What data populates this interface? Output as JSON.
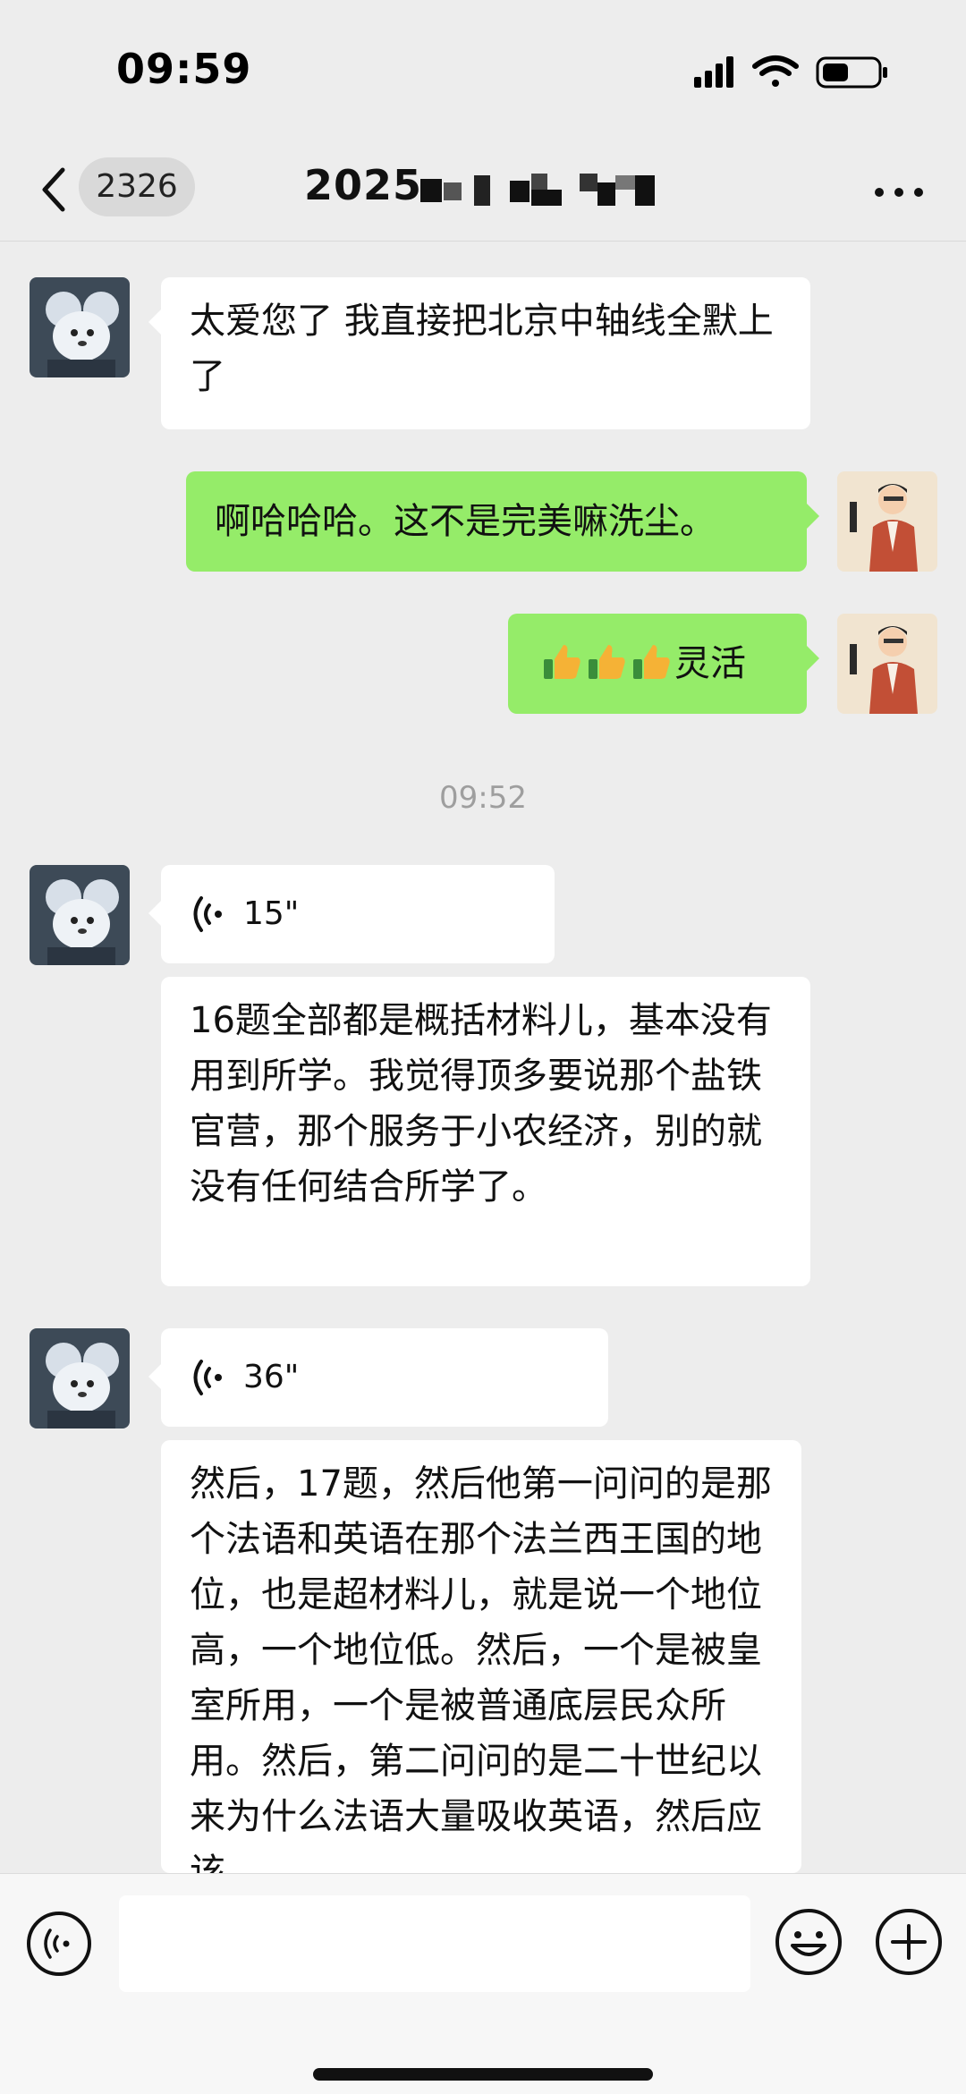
{
  "status_bar": {
    "time": "09:59"
  },
  "nav": {
    "unread_count": "2326",
    "title": "2025"
  },
  "messages": [
    {
      "id": "m1",
      "sender": "contact",
      "text": "太爱您了 我直接把北京中轴线全默上了"
    },
    {
      "id": "m2",
      "sender": "me",
      "text": "啊哈哈哈。这不是完美嘛洗尘。"
    },
    {
      "id": "m3",
      "sender": "me",
      "emoji": [
        "thumbs-up",
        "thumbs-up",
        "thumbs-up"
      ],
      "text": "灵活"
    },
    {
      "id": "t1",
      "type": "timestamp",
      "text": "09:52"
    },
    {
      "id": "v1",
      "sender": "contact",
      "type": "voice",
      "duration": "15\""
    },
    {
      "id": "m4",
      "sender": "contact",
      "text": "16题全部都是概括材料儿，基本没有用到所学。我觉得顶多要说那个盐铁官营，那个服务于小农经济，别的就没有任何结合所学了。"
    },
    {
      "id": "v2",
      "sender": "contact",
      "type": "voice",
      "duration": "36\""
    },
    {
      "id": "m5",
      "sender": "contact",
      "text": "然后，17题，然后他第一问问的是那个法语和英语在那个法兰西王国的地位，也是超材料儿，就是说一个地位高，一个地位低。然后，一个是被皇室所用，一个是被普通底层民众所用。然后，第二问问的是二十世纪以来为什么法语大量吸收英语，然后应该"
    }
  ],
  "input": {
    "placeholder": ""
  },
  "colors": {
    "background": "#ededed",
    "out_bubble": "#95ec69",
    "in_bubble": "#ffffff",
    "timestamp": "#9e9e9e"
  },
  "icons": {
    "back": "chevron-left-icon",
    "more": "more-dots-icon",
    "voice": "voice-icon",
    "emoji": "emoji-icon",
    "plus": "plus-icon"
  }
}
